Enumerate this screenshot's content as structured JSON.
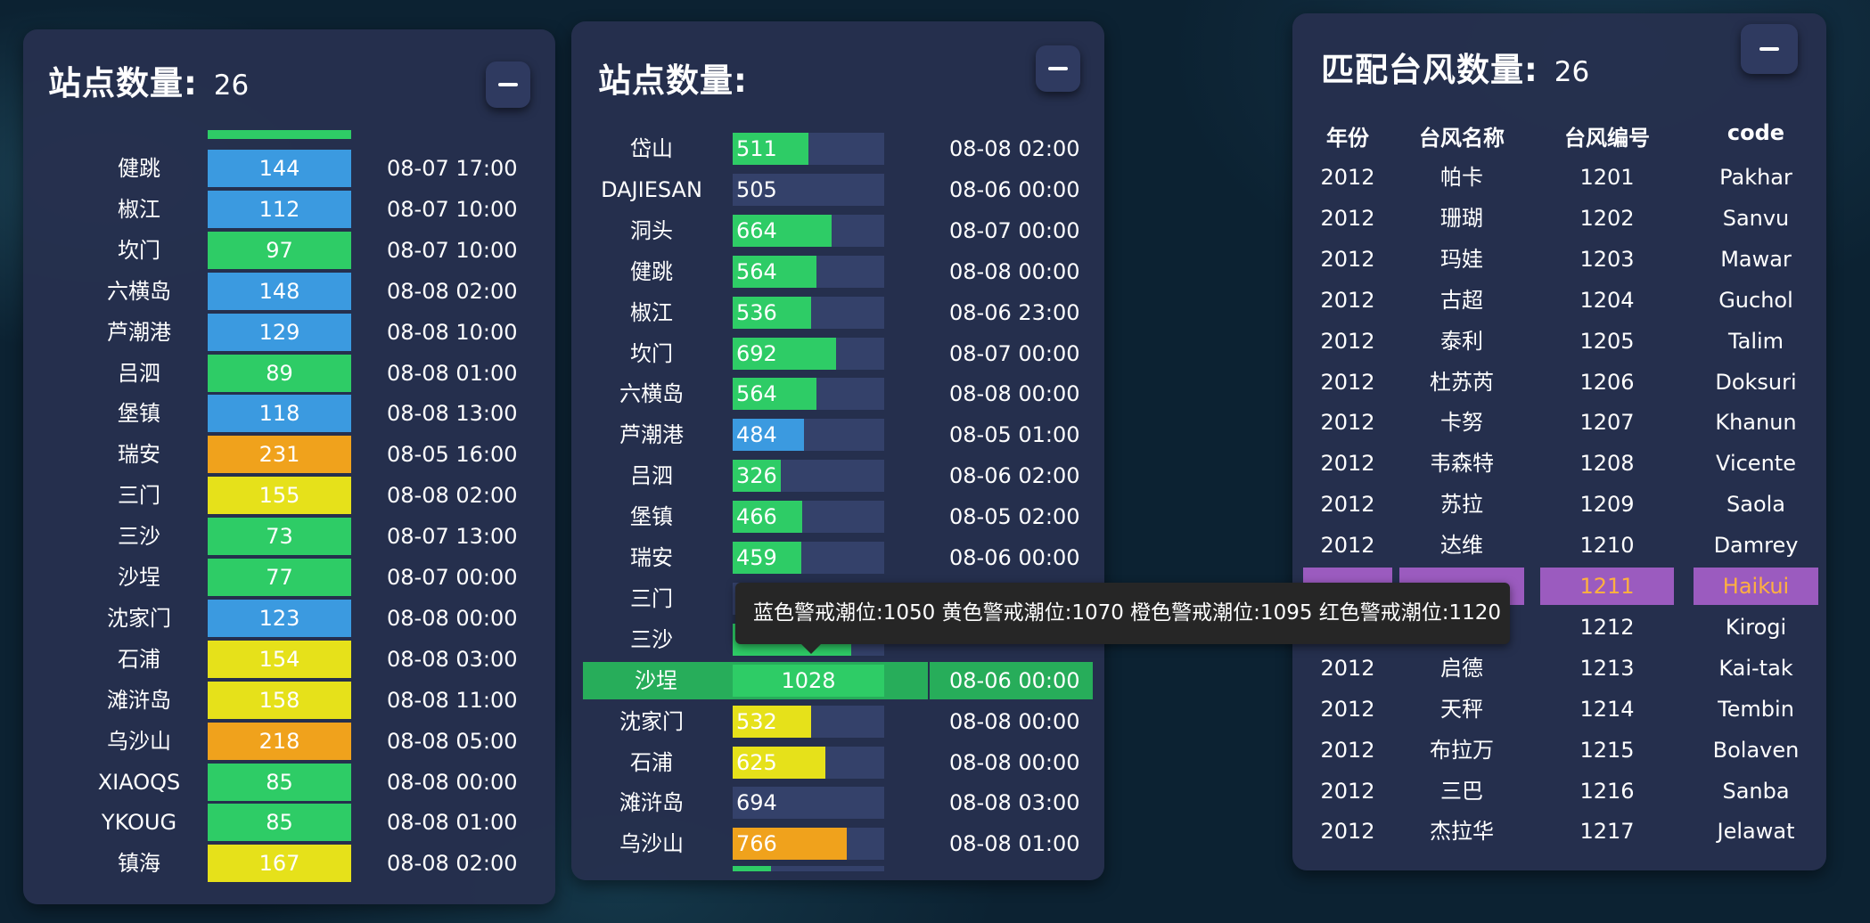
{
  "colors": {
    "blue": "#3b9ae0",
    "green": "#2ecc66",
    "orange": "#f0a21c",
    "yellow": "#e6e11a",
    "track": "#34416a",
    "highlight_green": "#27ad5a",
    "highlight_purple": "#9b5bbf"
  },
  "panel1": {
    "title": "站点数量:",
    "count": "26",
    "rows": [
      {
        "name": "健跳",
        "value": "144",
        "time": "08-07 17:00",
        "color": "blue"
      },
      {
        "name": "椒江",
        "value": "112",
        "time": "08-07 10:00",
        "color": "blue"
      },
      {
        "name": "坎门",
        "value": "97",
        "time": "08-07 10:00",
        "color": "green"
      },
      {
        "name": "六横岛",
        "value": "148",
        "time": "08-08 02:00",
        "color": "blue"
      },
      {
        "name": "芦潮港",
        "value": "129",
        "time": "08-08 10:00",
        "color": "blue"
      },
      {
        "name": "吕泗",
        "value": "89",
        "time": "08-08 01:00",
        "color": "green"
      },
      {
        "name": "堡镇",
        "value": "118",
        "time": "08-08 13:00",
        "color": "blue"
      },
      {
        "name": "瑞安",
        "value": "231",
        "time": "08-05 16:00",
        "color": "orange"
      },
      {
        "name": "三门",
        "value": "155",
        "time": "08-08 02:00",
        "color": "yellow"
      },
      {
        "name": "三沙",
        "value": "73",
        "time": "08-07 13:00",
        "color": "green"
      },
      {
        "name": "沙埕",
        "value": "77",
        "time": "08-07 00:00",
        "color": "green"
      },
      {
        "name": "沈家门",
        "value": "123",
        "time": "08-08 00:00",
        "color": "blue"
      },
      {
        "name": "石浦",
        "value": "154",
        "time": "08-08 03:00",
        "color": "yellow"
      },
      {
        "name": "滩浒岛",
        "value": "158",
        "time": "08-08 11:00",
        "color": "yellow"
      },
      {
        "name": "乌沙山",
        "value": "218",
        "time": "08-08 05:00",
        "color": "orange"
      },
      {
        "name": "XIAOQS",
        "value": "85",
        "time": "08-08 00:00",
        "color": "green"
      },
      {
        "name": "YKOUG",
        "value": "85",
        "time": "08-08 01:00",
        "color": "green"
      },
      {
        "name": "镇海",
        "value": "167",
        "time": "08-08 02:00",
        "color": "yellow"
      }
    ]
  },
  "panel2": {
    "title": "站点数量:",
    "rows": [
      {
        "name": "岱山",
        "value": "511",
        "time": "08-08 02:00",
        "color": "green",
        "fill": 0.5
      },
      {
        "name": "DAJIESAN",
        "value": "505",
        "time": "08-06 00:00",
        "color": "track",
        "fill": 0.49
      },
      {
        "name": "洞头",
        "value": "664",
        "time": "08-07 00:00",
        "color": "green",
        "fill": 0.65
      },
      {
        "name": "健跳",
        "value": "564",
        "time": "08-08 00:00",
        "color": "green",
        "fill": 0.55
      },
      {
        "name": "椒江",
        "value": "536",
        "time": "08-06 23:00",
        "color": "green",
        "fill": 0.52
      },
      {
        "name": "坎门",
        "value": "692",
        "time": "08-07 00:00",
        "color": "green",
        "fill": 0.68
      },
      {
        "name": "六横岛",
        "value": "564",
        "time": "08-08 00:00",
        "color": "green",
        "fill": 0.55
      },
      {
        "name": "芦潮港",
        "value": "484",
        "time": "08-05 01:00",
        "color": "blue",
        "fill": 0.47
      },
      {
        "name": "吕泗",
        "value": "326",
        "time": "08-06 02:00",
        "color": "green",
        "fill": 0.32
      },
      {
        "name": "堡镇",
        "value": "466",
        "time": "08-05 02:00",
        "color": "green",
        "fill": 0.46
      },
      {
        "name": "瑞安",
        "value": "459",
        "time": "08-06 00:00",
        "color": "green",
        "fill": 0.45
      },
      {
        "name": "三门",
        "value": "",
        "time": "",
        "color": "green",
        "fill": 0.0
      },
      {
        "name": "三沙",
        "value": "",
        "time": "",
        "color": "green",
        "fill": 0.78
      },
      {
        "name": "沙埕",
        "value": "1028",
        "time": "08-06 00:00",
        "color": "green",
        "fill": 1.0,
        "highlight": true
      },
      {
        "name": "沈家门",
        "value": "532",
        "time": "08-08 00:00",
        "color": "yellow",
        "fill": 0.52
      },
      {
        "name": "石浦",
        "value": "625",
        "time": "08-08 00:00",
        "color": "yellow",
        "fill": 0.61
      },
      {
        "name": "滩浒岛",
        "value": "694",
        "time": "08-08 03:00",
        "color": "track",
        "fill": 0.68
      },
      {
        "name": "乌沙山",
        "value": "766",
        "time": "08-08 01:00",
        "color": "orange",
        "fill": 0.75
      }
    ]
  },
  "tooltip": {
    "text": "蓝色警戒潮位:1050 黄色警戒潮位:1070 橙色警戒潮位:1095 红色警戒潮位:1120"
  },
  "panel3": {
    "title": "匹配台风数量:",
    "count": "26",
    "headers": [
      "年份",
      "台风名称",
      "台风编号",
      "code"
    ],
    "rows": [
      {
        "year": "2012",
        "name": "帕卡",
        "no": "1201",
        "code": "Pakhar"
      },
      {
        "year": "2012",
        "name": "珊瑚",
        "no": "1202",
        "code": "Sanvu"
      },
      {
        "year": "2012",
        "name": "玛娃",
        "no": "1203",
        "code": "Mawar"
      },
      {
        "year": "2012",
        "name": "古超",
        "no": "1204",
        "code": "Guchol"
      },
      {
        "year": "2012",
        "name": "泰利",
        "no": "1205",
        "code": "Talim"
      },
      {
        "year": "2012",
        "name": "杜苏芮",
        "no": "1206",
        "code": "Doksuri"
      },
      {
        "year": "2012",
        "name": "卡努",
        "no": "1207",
        "code": "Khanun"
      },
      {
        "year": "2012",
        "name": "韦森特",
        "no": "1208",
        "code": "Vicente"
      },
      {
        "year": "2012",
        "name": "苏拉",
        "no": "1209",
        "code": "Saola"
      },
      {
        "year": "2012",
        "name": "达维",
        "no": "1210",
        "code": "Damrey"
      },
      {
        "year": "",
        "name": "",
        "no": "1211",
        "code": "Haikui",
        "highlight": true
      },
      {
        "year": "",
        "name": "",
        "no": "1212",
        "code": "Kirogi"
      },
      {
        "year": "2012",
        "name": "启德",
        "no": "1213",
        "code": "Kai-tak"
      },
      {
        "year": "2012",
        "name": "天秤",
        "no": "1214",
        "code": "Tembin"
      },
      {
        "year": "2012",
        "name": "布拉万",
        "no": "1215",
        "code": "Bolaven"
      },
      {
        "year": "2012",
        "name": "三巴",
        "no": "1216",
        "code": "Sanba"
      },
      {
        "year": "2012",
        "name": "杰拉华",
        "no": "1217",
        "code": "Jelawat"
      }
    ]
  }
}
